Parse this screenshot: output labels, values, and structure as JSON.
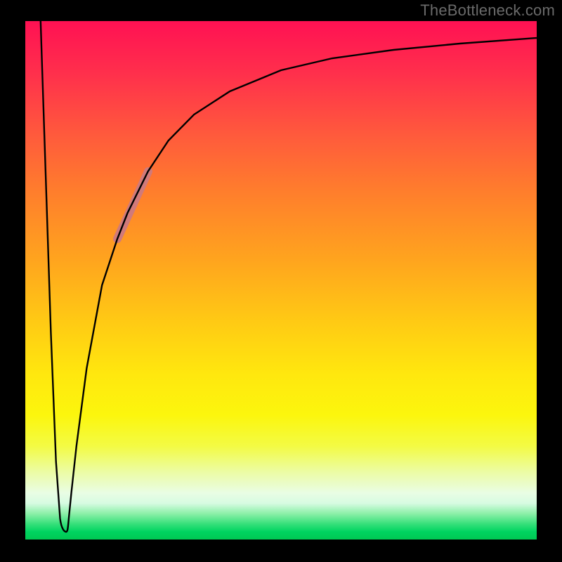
{
  "watermark": "TheBottleneck.com",
  "chart_data": {
    "type": "line",
    "title": "",
    "xlabel": "",
    "ylabel": "",
    "xlim": [
      0,
      100
    ],
    "ylim": [
      0,
      100
    ],
    "grid": false,
    "legend": false,
    "background": {
      "type": "vertical-gradient",
      "stops": [
        {
          "pos": 0.0,
          "color": "#ff1153"
        },
        {
          "pos": 0.1,
          "color": "#ff2f4c"
        },
        {
          "pos": 0.22,
          "color": "#ff5a3c"
        },
        {
          "pos": 0.33,
          "color": "#ff7e2c"
        },
        {
          "pos": 0.46,
          "color": "#ffa41e"
        },
        {
          "pos": 0.58,
          "color": "#ffca14"
        },
        {
          "pos": 0.68,
          "color": "#ffe70e"
        },
        {
          "pos": 0.76,
          "color": "#fcf60d"
        },
        {
          "pos": 0.82,
          "color": "#f3fb44"
        },
        {
          "pos": 0.87,
          "color": "#ecfca5"
        },
        {
          "pos": 0.91,
          "color": "#e9fde4"
        },
        {
          "pos": 0.93,
          "color": "#d7fbe2"
        },
        {
          "pos": 0.95,
          "color": "#8cf0a8"
        },
        {
          "pos": 0.97,
          "color": "#36e07a"
        },
        {
          "pos": 0.985,
          "color": "#00d460"
        },
        {
          "pos": 1.0,
          "color": "#00c853"
        }
      ]
    },
    "series": [
      {
        "name": "bottleneck-curve",
        "color": "#000000",
        "stroke_width": 2.4,
        "x": [
          3.0,
          4.0,
          5.0,
          6.0,
          6.8,
          7.5,
          8.0,
          8.5,
          9.0,
          10.0,
          12.0,
          15.0,
          18.0,
          20.0,
          24.0,
          28.0,
          33.0,
          40.0,
          50.0,
          60.0,
          72.0,
          85.0,
          100.0
        ],
        "y": [
          100.0,
          70.0,
          40.0,
          15.0,
          4.0,
          1.5,
          1.5,
          4.0,
          9.0,
          18.0,
          33.0,
          49.0,
          58.0,
          63.0,
          71.0,
          77.0,
          82.0,
          86.5,
          90.5,
          92.8,
          94.5,
          95.7,
          96.7
        ]
      },
      {
        "name": "highlight-segment",
        "color": "#d07a7a",
        "stroke_width": 12,
        "x": [
          18.0,
          24.0
        ],
        "y": [
          58.0,
          71.0
        ]
      }
    ]
  }
}
